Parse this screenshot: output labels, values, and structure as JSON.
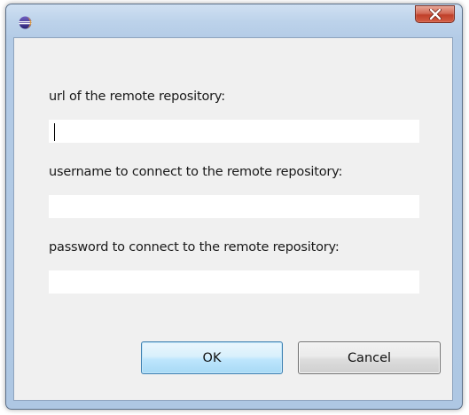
{
  "dialog": {
    "url_label": "url of the remote repository:",
    "url_value": "",
    "username_label": "username to connect to the remote repository:",
    "username_value": "",
    "password_label": "password to connect to the remote repository:",
    "password_value": "",
    "ok_label": "OK",
    "cancel_label": "Cancel"
  },
  "title_bar": {
    "app_icon": "eclipse-icon",
    "close_icon": "close-icon"
  },
  "colors": {
    "close_button": "#c8452f",
    "ok_button_border": "#3c7fb1",
    "client_background": "#f0f0f0"
  }
}
